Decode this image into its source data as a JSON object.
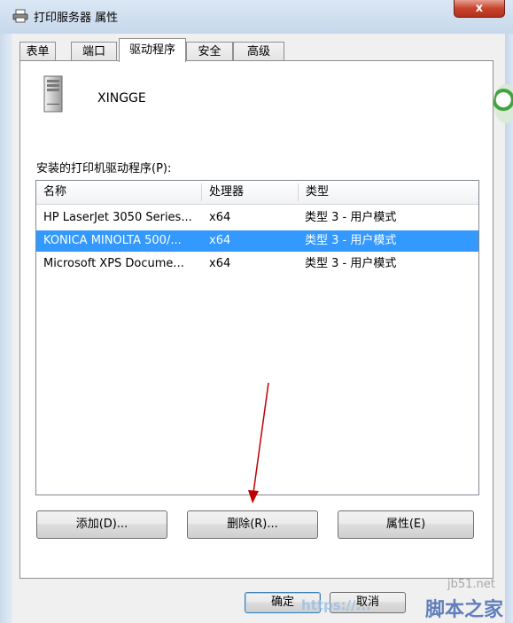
{
  "window": {
    "title": "打印服务器 属性",
    "close_glyph": "x"
  },
  "tabs": [
    {
      "label": "表单",
      "active": false
    },
    {
      "label": "端口",
      "active": false
    },
    {
      "label": "驱动程序",
      "active": true
    },
    {
      "label": "安全",
      "active": false
    },
    {
      "label": "高级",
      "active": false
    }
  ],
  "server": {
    "icon": "server-icon",
    "name": "XINGGE"
  },
  "drivers": {
    "label": "安装的打印机驱动程序(P):",
    "columns": [
      "名称",
      "处理器",
      "类型"
    ],
    "rows": [
      {
        "name": "HP LaserJet 3050 Series...",
        "processor": "x64",
        "type": "类型 3 - 用户模式",
        "selected": false
      },
      {
        "name": "KONICA MINOLTA 500/...",
        "processor": "x64",
        "type": "类型 3 - 用户模式",
        "selected": true
      },
      {
        "name": "Microsoft XPS Docume...",
        "processor": "x64",
        "type": "类型 3 - 用户模式",
        "selected": false
      }
    ]
  },
  "buttons": {
    "add": "添加(D)...",
    "remove": "删除(R)...",
    "properties": "属性(E)",
    "ok": "确定",
    "cancel": "取消"
  },
  "watermark": {
    "site": "jb51.net",
    "url": "https://...",
    "brand": "脚本之家"
  },
  "colors": {
    "selection": "#3399ff",
    "annotation_arrow": "#c00000"
  }
}
